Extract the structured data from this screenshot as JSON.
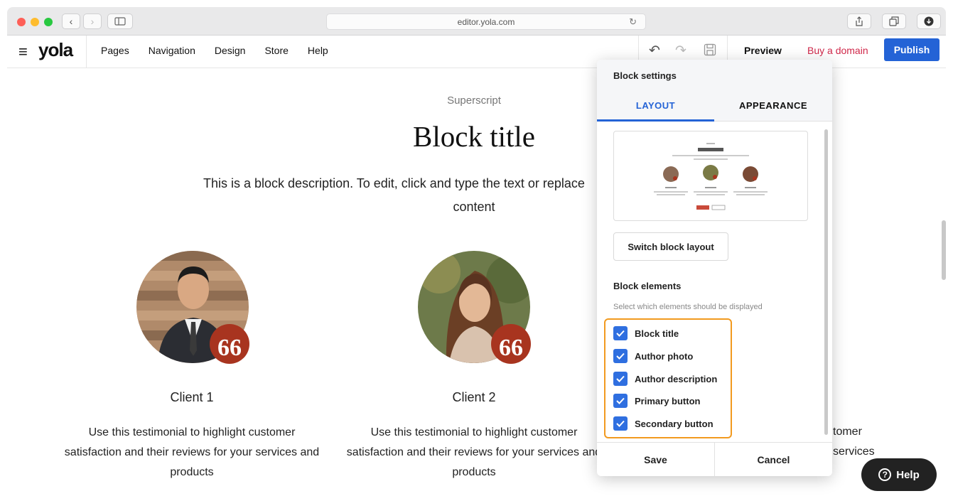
{
  "browser": {
    "url": "editor.yola.com",
    "colors": {
      "close": "#fe5f57",
      "minimize": "#febc2e",
      "maximize": "#28c840"
    }
  },
  "app": {
    "logo": "yola",
    "nav": [
      "Pages",
      "Navigation",
      "Design",
      "Store",
      "Help"
    ],
    "preview_label": "Preview",
    "buy_domain_label": "Buy a domain",
    "publish_label": "Publish",
    "accent_color": "#2463d6"
  },
  "page": {
    "superscript": "Superscript",
    "block_title": "Block title",
    "description_line1": "This is a block description. To edit, click and type the text or replace",
    "description_line2": "content",
    "clients": [
      {
        "name": "Client 1",
        "text": "Use this testimonial to highlight customer satisfaction and their reviews for your services and products"
      },
      {
        "name": "Client 2",
        "text": "Use this testimonial to highlight customer satisfaction and their reviews for your services and products"
      }
    ],
    "partial_text_1": "tomer",
    "partial_text_2": "services",
    "quote_glyph": "66"
  },
  "panel": {
    "title": "Block settings",
    "tabs": [
      "LAYOUT",
      "APPEARANCE"
    ],
    "active_tab": "LAYOUT",
    "switch_layout_label": "Switch block layout",
    "elements_title": "Block elements",
    "elements_subtitle": "Select which elements should be displayed",
    "elements": [
      {
        "label": "Block title",
        "checked": true
      },
      {
        "label": "Author photo",
        "checked": true
      },
      {
        "label": "Author description",
        "checked": true
      },
      {
        "label": "Primary button",
        "checked": true
      },
      {
        "label": "Secondary button",
        "checked": true
      }
    ],
    "save_label": "Save",
    "cancel_label": "Cancel"
  },
  "help_label": "Help"
}
